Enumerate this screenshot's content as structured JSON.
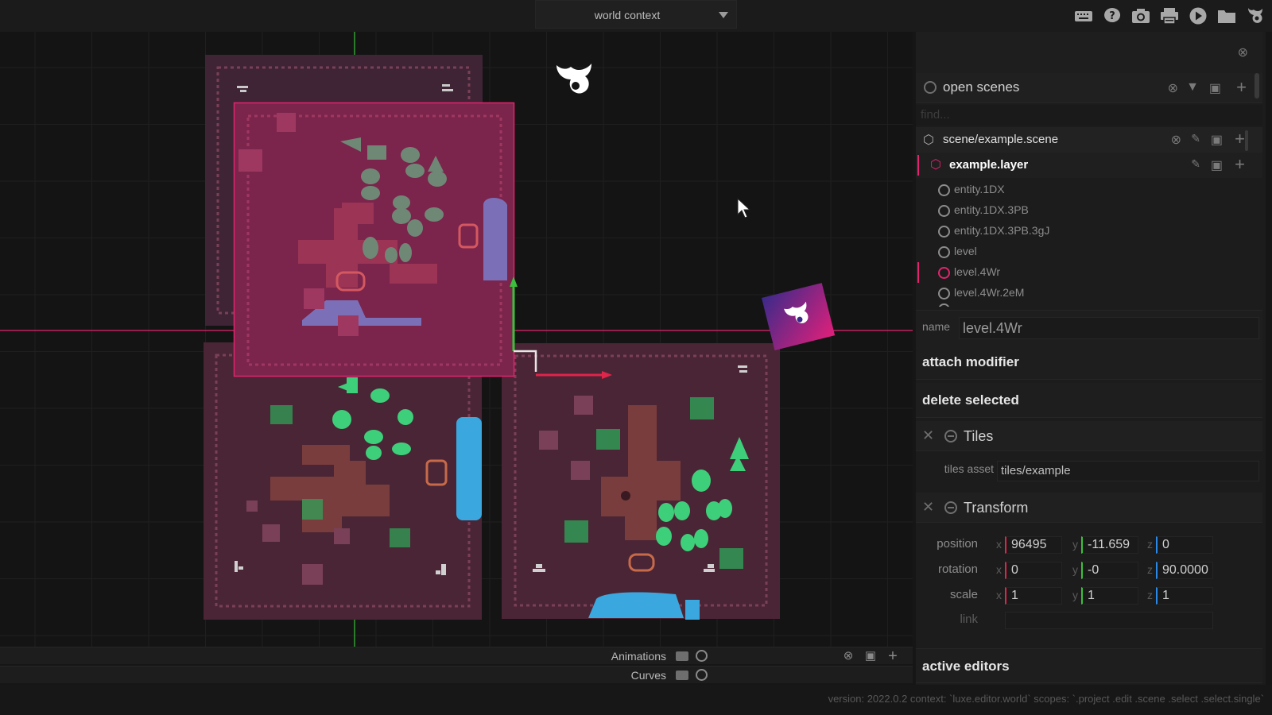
{
  "topbar": {
    "context_label": "world context",
    "icons": [
      "keyboard-icon",
      "help-icon",
      "camera-icon",
      "printer-icon",
      "play-icon",
      "folder-icon",
      "luxe-logo-icon"
    ]
  },
  "panel": {
    "open_scenes": {
      "title": "open scenes",
      "find_placeholder": "find...",
      "scene_name": "scene/example.scene",
      "layer_name": "example.layer",
      "items": [
        "entity.1DX",
        "entity.1DX.3PB",
        "entity.1DX.3PB.3gJ",
        "level",
        "level.4Wr",
        "level.4Wr.2eM"
      ]
    },
    "name_label": "name",
    "name_value": "level.4Wr",
    "attach_modifier": "attach modifier",
    "delete_selected": "delete selected",
    "tiles": {
      "title": "Tiles",
      "asset_label": "tiles asset",
      "asset_value": "tiles/example"
    },
    "transform": {
      "title": "Transform",
      "position_label": "position",
      "rotation_label": "rotation",
      "scale_label": "scale",
      "link_label": "link",
      "position": {
        "x": "96495",
        "y": "-11.659",
        "z": "0"
      },
      "rotation": {
        "x": "0",
        "y": "-0",
        "z": "90.0000"
      },
      "scale": {
        "x": "1",
        "y": "1",
        "z": "1"
      },
      "link": ""
    },
    "active_editors": "active editors"
  },
  "bottom": {
    "animations": "Animations",
    "curves": "Curves"
  },
  "status": {
    "version": "version: 2022.0.2 context: `luxe.editor.world` scopes: `.project .edit .scene .select .select.single`"
  },
  "colors": {
    "selection": "#e0246e",
    "water": "#3aa7df",
    "foliage": "#3ecf7a",
    "path": "#8a4a4a",
    "tile_bg": "#4a2535"
  }
}
